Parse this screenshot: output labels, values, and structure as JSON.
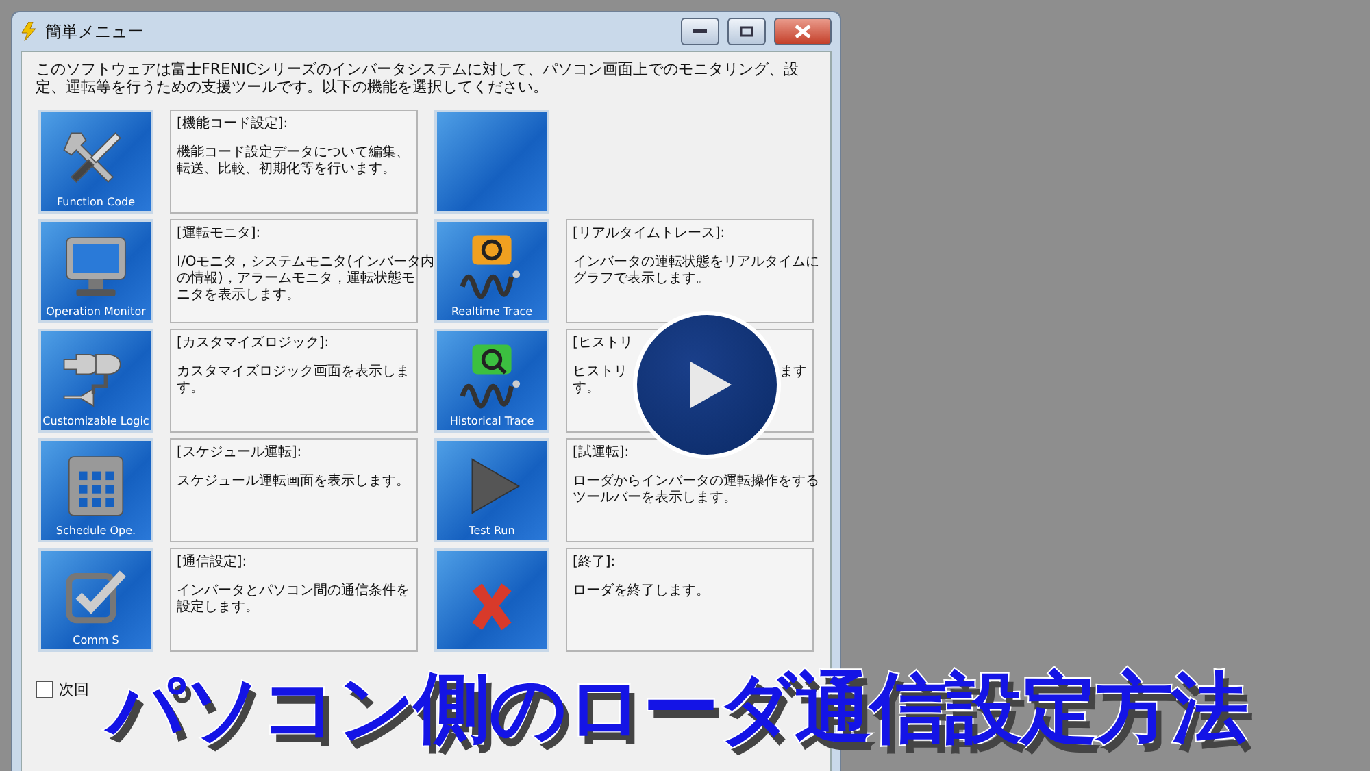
{
  "window": {
    "title": "簡単メニュー"
  },
  "intro": "このソフトウェアは富士FRENICシリーズのインバータシステムに対して、パソコン画面上でのモニタリング、設定、運転等を行うための支援ツールです。以下の機能を選択してください。",
  "rows": [
    [
      {
        "kind": "tools",
        "label": "Function Code",
        "title": "[機能コード設定]:",
        "body": [
          [
            "機能コード設定データについて編集、"
          ],
          [
            "転送、比較、初期化等を行います。"
          ]
        ]
      },
      {
        "kind": "blank"
      }
    ],
    [
      {
        "kind": "monitor",
        "label": "Operation Monitor",
        "title": "[運転モニタ]:",
        "body": [
          [
            "I/Oモニタ，システムモニタ(インバータ内"
          ],
          [
            "の情報)，アラームモニタ，運転状態モ"
          ],
          [
            "ニタを表示します。"
          ]
        ]
      },
      {
        "kind": "realtime",
        "label": "Realtime Trace",
        "title": "[リアルタイムトレース]:",
        "body": [
          [
            "インバータの運転状態をリアルタイムに"
          ],
          [
            "グラフで表示します。"
          ]
        ]
      }
    ],
    [
      {
        "kind": "logic",
        "label": "Customizable Logic",
        "title": "[カスタマイズロジック]:",
        "body": [
          [
            "カスタマイズロジック画面を表示しま"
          ],
          [
            "す。"
          ]
        ]
      },
      {
        "kind": "historical",
        "label": "Historical Trace",
        "title": "[ヒストリ",
        "body": [
          [
            "ヒストリ",
            "ます"
          ],
          [
            "す。"
          ]
        ]
      }
    ],
    [
      {
        "kind": "schedule",
        "label": "Schedule Ope.",
        "title": "[スケジュール運転]:",
        "body": [
          [
            "スケジュール運転画面を表示します。"
          ]
        ]
      },
      {
        "kind": "testrun",
        "label": "Test Run",
        "title": "[試運転]:",
        "body": [
          [
            "ローダからインバータの運転操作をする"
          ],
          [
            "ツールバーを表示します。"
          ]
        ]
      }
    ],
    [
      {
        "kind": "comm",
        "label": "Comm S",
        "title": "[通信設定]:",
        "body": [
          [
            "インバータとパソコン間の通信条件を"
          ],
          [
            "設定します。"
          ]
        ]
      },
      {
        "kind": "exit",
        "title": "[終了]:",
        "body": [
          [
            "ローダを終了します。"
          ]
        ]
      }
    ]
  ],
  "startup_checkbox": {
    "label": "次回",
    "checked": false
  },
  "caption": "パソコン側のローダ通信設定方法"
}
